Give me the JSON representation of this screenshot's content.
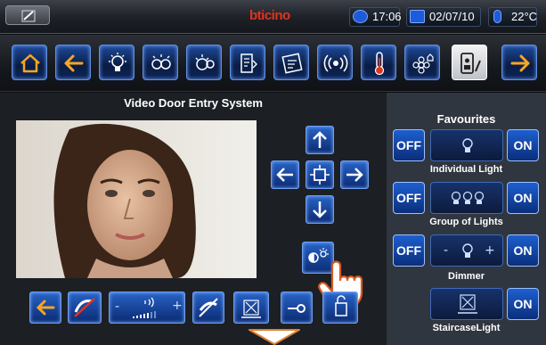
{
  "header": {
    "brand": "bticino",
    "time": "17:06",
    "date": "02/07/10",
    "temperature": "22°C"
  },
  "nav": {
    "icons": [
      "home-icon",
      "back-arrow-icon",
      "light-bulb-icon",
      "lights-group-icon",
      "dimmer-icon",
      "scenario-icon",
      "messages-icon",
      "sound-system-icon",
      "thermometer-icon",
      "settings-flower-icon",
      "video-door-entry-icon",
      "forward-arrow-icon"
    ],
    "selected": "video-door-entry-icon"
  },
  "main": {
    "title": "Video Door Entry System"
  },
  "favourites": {
    "title": "Favourites",
    "items": [
      {
        "label": "Individual Light",
        "off": "OFF",
        "on": "ON"
      },
      {
        "label": "Group of Lights",
        "off": "OFF",
        "on": "ON"
      },
      {
        "label": "Dimmer",
        "off": "OFF",
        "on": "ON",
        "minus": "-",
        "plus": "+"
      },
      {
        "label": "StaircaseLight",
        "on": "ON"
      }
    ]
  },
  "volume": {
    "minus": "-",
    "plus": "+"
  },
  "colors": {
    "accent_blue": "#1e5bd8",
    "button_border": "#6e9ef0",
    "arrow_orange": "#f5a623",
    "brand_red": "#e0341d",
    "panel_dark": "#1c1f24",
    "panel_right": "#30363f"
  }
}
